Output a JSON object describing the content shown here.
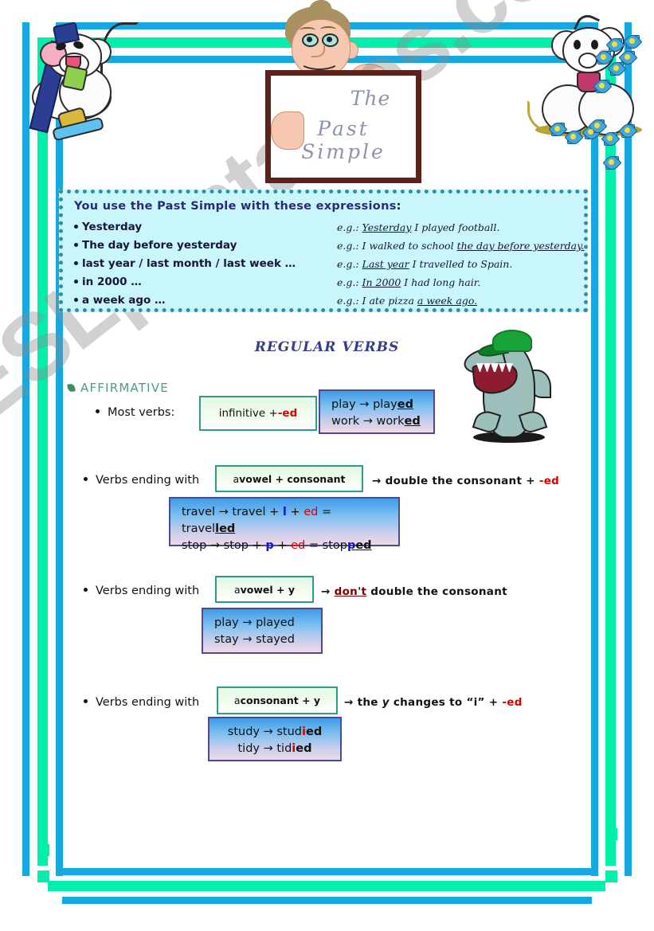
{
  "worksheet": {
    "title_line1": "The",
    "title_line2": "Past Simple",
    "watermark": "ESLprintables.com"
  },
  "expressions_box": {
    "heading_bold": "You use the Past Simple with these expressions",
    "heading_suffix": ":",
    "rows": [
      {
        "expression": "Yesterday",
        "example_prefix": "e.g.: ",
        "example_underlined_lead": "Yesterday",
        "example_rest": " I played football."
      },
      {
        "expression": "The day before yesterday",
        "example_prefix": "e.g.: ",
        "example_plain_lead": "I walked to school ",
        "example_underlined_tail": "the day before    yesterday."
      },
      {
        "expression": "last year / last month / last week …",
        "example_prefix": "e.g.: ",
        "example_underlined_lead": "Last year",
        "example_rest": " I travelled to Spain."
      },
      {
        "expression": "in 2000 …",
        "example_prefix": "e.g.: ",
        "example_underlined_lead": "In 2000",
        "example_rest": " I had long hair."
      },
      {
        "expression": "a week ago …",
        "example_prefix": "e.g.: ",
        "example_plain_lead": "I ate pizza ",
        "example_underlined_tail": "a week ago."
      }
    ]
  },
  "regular_verbs": {
    "section_title": "REGULAR VERBS",
    "affirmative_label": "AFFIRMATIVE",
    "rules": [
      {
        "bullet": "Most verbs:",
        "formula_prefix": "infinitive + ",
        "formula_accent": "-ed",
        "examples": [
          {
            "stem": "play → play",
            "ending": "ed"
          },
          {
            "stem": "work  → work",
            "ending": "ed"
          }
        ]
      },
      {
        "bullet": "Verbs ending with",
        "formula_a": "a ",
        "formula_b": "vowel + consonant",
        "arrow": "→ double the consonant + ",
        "arrow_accent": "-ed",
        "example_lines": [
          "travel → travel + l + ed = travelled",
          "stop → stop + p + ed = stopped"
        ]
      },
      {
        "bullet": "Verbs ending with",
        "formula_a": "a ",
        "formula_b": "vowel + y",
        "arrow_pre": "→ ",
        "arrow_dont": "don't",
        "arrow_post": " double the consonant",
        "example_lines": [
          "play → played",
          "stay → stayed"
        ]
      },
      {
        "bullet": "Verbs ending with",
        "formula_a": "a ",
        "formula_b": "consonant  + y",
        "arrow_pre": "→ the ",
        "arrow_y": "y",
        "arrow_mid": " changes to “i” + ",
        "arrow_accent": "-ed",
        "example_lines": [
          "study → studied",
          "tidy → tidied"
        ]
      }
    ]
  },
  "colors": {
    "frame_blue": "#16A8E0",
    "frame_green": "#00EFAC",
    "box_cyan": "#C9F6FB",
    "box_border_teal": "#2E8FA6",
    "heading_navy": "#2A2A7A",
    "affirmative_green": "#4B9E7A",
    "accent_red": "#D90000",
    "board_border_brown": "#5B231C"
  }
}
